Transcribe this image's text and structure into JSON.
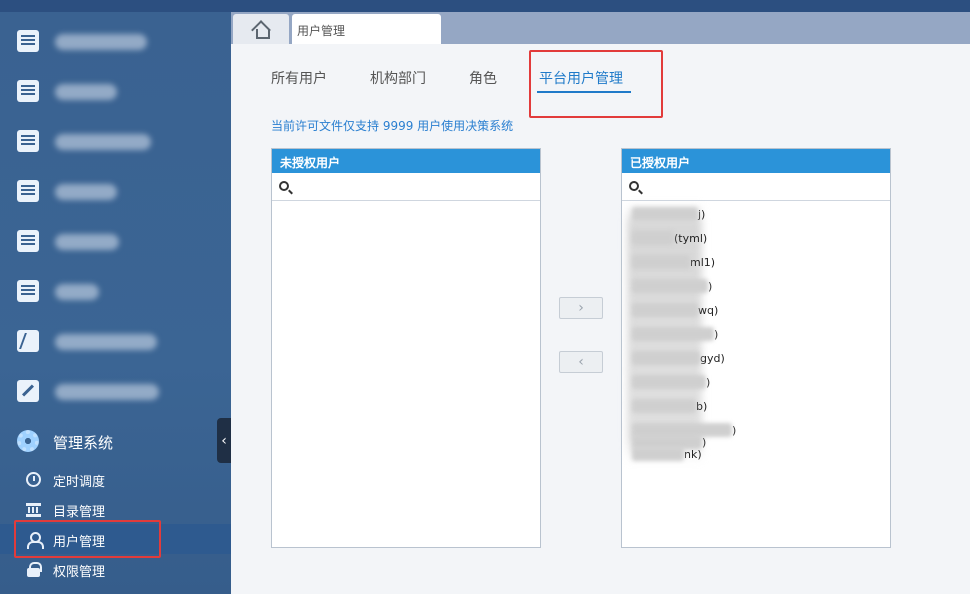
{
  "tabs": {
    "page_tab_label": "用户管理"
  },
  "sidebar": {
    "management_label": "管理系统",
    "sub_items": [
      {
        "label": "定时调度"
      },
      {
        "label": "目录管理"
      },
      {
        "label": "用户管理"
      },
      {
        "label": "权限管理"
      }
    ],
    "collapse_glyph": "‹"
  },
  "subtabs": [
    {
      "label": "所有用户"
    },
    {
      "label": "机构部门"
    },
    {
      "label": "角色"
    },
    {
      "label": "平台用户管理"
    }
  ],
  "license_note": "当前许可文件仅支持 9999 用户使用决策系统",
  "unauthorized_panel": {
    "title": "未授权用户",
    "search_value": ""
  },
  "authorized_panel": {
    "title": "已授权用户",
    "search_value": "",
    "rows": [
      {
        "visible": "j)"
      },
      {
        "visible": "(tyml)"
      },
      {
        "visible": "ml1)"
      },
      {
        "visible": ")"
      },
      {
        "visible": "wq)"
      },
      {
        "visible": ")"
      },
      {
        "visible": "gyd)"
      },
      {
        "visible": ")"
      },
      {
        "visible": "b)"
      },
      {
        "visible": ")"
      },
      {
        "visible": ")"
      },
      {
        "visible": "nk)"
      }
    ]
  },
  "buttons": {
    "add_glyph": "›",
    "remove_glyph": "‹"
  },
  "colors": {
    "sidebar": "#3b6594",
    "accent": "#1f7ac9",
    "panel_header": "#2b93d9",
    "highlight_box": "#e23b3b"
  }
}
